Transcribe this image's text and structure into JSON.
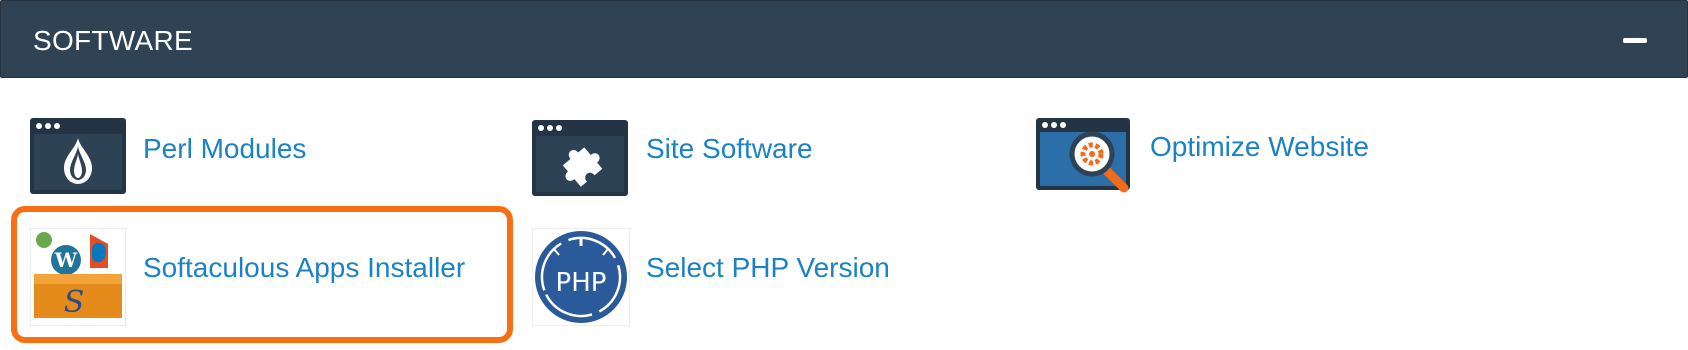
{
  "panel": {
    "title": "SOFTWARE",
    "collapse_icon": "minus-icon"
  },
  "items": [
    {
      "label": "Perl Modules",
      "icon": "perl-onion-icon"
    },
    {
      "label": "Site Software",
      "icon": "puzzle-piece-icon"
    },
    {
      "label": "Optimize Website",
      "icon": "magnifier-gear-icon"
    },
    {
      "label": "Softaculous Apps Installer",
      "icon": "softaculous-icon"
    },
    {
      "label": "Select PHP Version",
      "icon": "php-gauge-icon",
      "icon_text": "PHP"
    }
  ],
  "colors": {
    "header_bg": "#304355",
    "link": "#1b82c5",
    "highlight": "#f66f14"
  }
}
